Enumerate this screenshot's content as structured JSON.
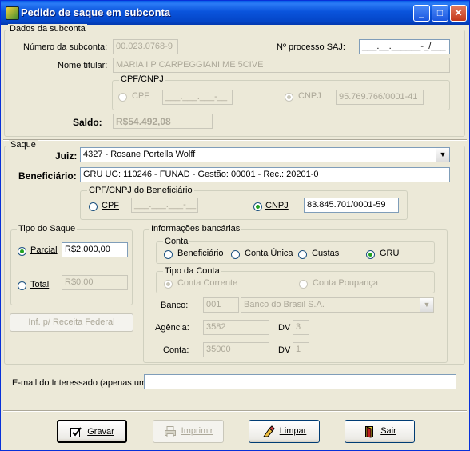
{
  "window": {
    "title": "Pedido de saque em subconta",
    "min": "_",
    "max": "□",
    "close": "✕"
  },
  "dados": {
    "legend": "Dados da subconta",
    "numero_label": "Número da subconta:",
    "numero_value": "00.023.0768-9",
    "processo_label": "Nº processo SAJ:",
    "processo_value": "___.__.______-_/___",
    "nome_label": "Nome titular:",
    "nome_value": "MARIA I P CARPEGGIANI ME 5CIVE",
    "cpfcnpj_legend": "CPF/CNPJ",
    "cpf_label": "CPF",
    "cpf_value": "___.___.___-__",
    "cnpj_label": "CNPJ",
    "cnpj_value": "95.769.766/0001-41",
    "saldo_label": "Saldo:",
    "saldo_value": "R$54.492,08"
  },
  "saque": {
    "legend": "Saque",
    "juiz_label": "Juiz:",
    "juiz_value": "4327 - Rosane Portella Wolff",
    "benef_label": "Beneficiário:",
    "benef_value": "GRU UG: 110246 - FUNAD - Gestão: 00001 - Rec.: 20201-0",
    "doc_legend": "CPF/CNPJ do Beneficiário",
    "cpf_label": "CPF",
    "cpf_value": "___.___.___-__",
    "cnpj_label": "CNPJ",
    "cnpj_value": "83.845.701/0001-59"
  },
  "tipo": {
    "legend": "Tipo do Saque",
    "parcial_label": "Parcial",
    "parcial_value": "R$2.000,00",
    "total_label": "Total",
    "total_value": "R$0,00"
  },
  "receita_button": "Inf. p/ Receita Federal",
  "bancarias": {
    "legend": "Informações bancárias",
    "conta_legend": "Conta",
    "opt_beneficiario": "Beneficiário",
    "opt_conta_unica": "Conta Única",
    "opt_custas": "Custas",
    "opt_gru": "GRU",
    "tipo_legend": "Tipo da Conta",
    "opt_corrente": "Conta Corrente",
    "opt_poupanca": "Conta Poupança",
    "banco_label": "Banco:",
    "banco_code": "001",
    "banco_name": "Banco do Brasil S.A.",
    "agencia_label": "Agência:",
    "agencia_value": "3582",
    "agencia_dv_label": "DV",
    "agencia_dv_value": "3",
    "conta_label": "Conta:",
    "conta_value": "35000",
    "conta_dv_label": "DV",
    "conta_dv_value": "1"
  },
  "email": {
    "label": "E-mail do Interessado (apenas um):",
    "value": ""
  },
  "buttons": {
    "gravar": "Gravar",
    "imprimir": "Imprimir",
    "limpar": "Limpar",
    "sair": "Sair"
  }
}
